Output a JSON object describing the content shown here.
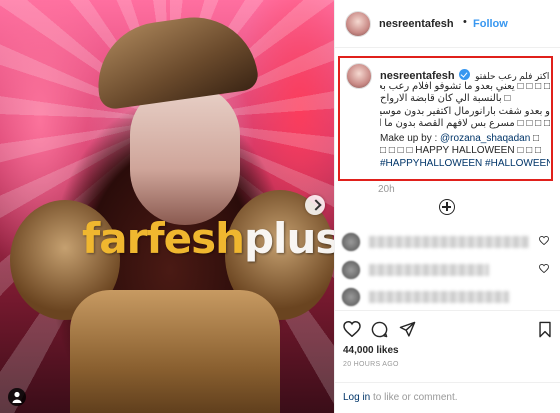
{
  "post": {
    "username": "nesreentafesh",
    "follow_label": "Follow",
    "dot": "•"
  },
  "watermark": {
    "part_a": "farfesh",
    "part_b": "plus.com"
  },
  "caption": {
    "username": "nesreentafesh",
    "lines": [
      "شو اكتر فلم رعب حلفتو",
      "□ □ □ □ يعني بعدو ما تشوفو افلام رعب بحياتكون",
      "□ بالنسبة الي كان قابضة الارواح",
      "و بعدو شفت بارانورمال اكتفير بدون موسيقا و",
      "□ □ □ □ مسرع بس لافهم القصة بدون ما ارتعب"
    ],
    "makeup_prefix": "Make up by : ",
    "makeup_mention": "@rozana_shaqadan",
    "makeup_suffix": " □",
    "halloween_line": "□ □ □ □ HAPPY HALLOWEEN □ □ □",
    "hashtag_1": "#HAPPYHALLOWEEN",
    "hashtag_2": "#HALLOWEEN"
  },
  "timestamp": "20h",
  "likes": "44,000 likes",
  "time_ago": "20 HOURS AGO",
  "login": {
    "login_label": "Log in",
    "rest": " to like or comment."
  },
  "icons": [
    "heart-icon",
    "comment-icon",
    "share-icon",
    "bookmark-icon",
    "add-comment-icon",
    "chevron-right-icon",
    "tagged-person-icon",
    "verified-badge-icon"
  ],
  "colors": {
    "follow": "#3897f0",
    "highlight_border": "#e0201b",
    "link": "#003569",
    "watermark_a": "#f0b72f"
  }
}
